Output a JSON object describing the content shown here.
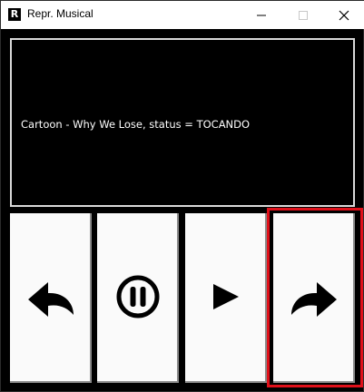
{
  "window": {
    "icon_letter": "R",
    "title": "Repr. Musical",
    "controls": {
      "minimize_icon": "minimize-icon",
      "maximize_icon": "maximize-icon",
      "close_icon": "close-icon"
    }
  },
  "display": {
    "status_text": "Cartoon - Why We Lose, status = TOCANDO"
  },
  "player_controls": [
    {
      "action": "previous",
      "icon": "curved-arrow-left-icon"
    },
    {
      "action": "pause",
      "icon": "pause-circle-icon"
    },
    {
      "action": "play",
      "icon": "play-triangle-icon"
    },
    {
      "action": "next",
      "icon": "curved-arrow-right-icon",
      "highlighted": true
    }
  ],
  "colors": {
    "background": "#000000",
    "button_face": "#fafafa",
    "highlight": "#e0101a"
  }
}
